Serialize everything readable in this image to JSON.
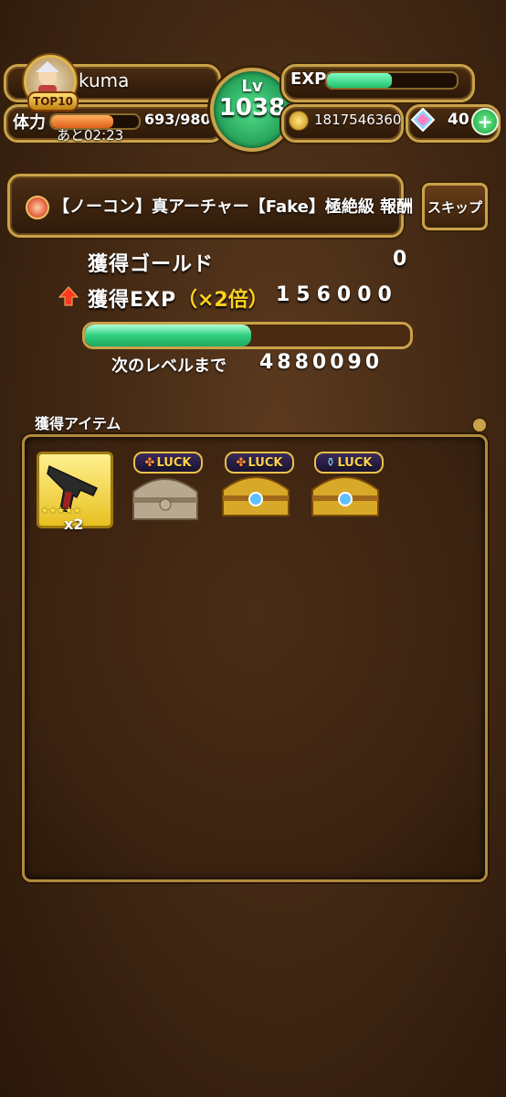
{
  "player": {
    "name": "kuma",
    "rank_badge": "TOP10",
    "level_label": "Lv",
    "level": "1038",
    "exp_label": "EXP",
    "exp_progress": 0.5,
    "stamina_label": "体力",
    "stamina_value": "693/980",
    "stamina_progress": 0.707,
    "stamina_timer": "あと02:23",
    "gold": "1817546360",
    "gems": "40"
  },
  "quest": {
    "title": "【ノーコン】真アーチャー【Fake】極絶級 報酬",
    "skip_label": "スキップ"
  },
  "rewards": {
    "gold_label": "獲得ゴールド",
    "gold_value": "0",
    "exp_label": "獲得EXP",
    "exp_multiplier": "（×2倍）",
    "exp_value": "156000",
    "next_level_label": "次のレベルまで",
    "next_level_value": "4880090",
    "next_level_progress": 0.51
  },
  "items": {
    "section_label": "獲得アイテム",
    "list": [
      {
        "type": "weapon",
        "icon": "pistol-icon",
        "stars": 5,
        "count": "x2"
      },
      {
        "type": "chest",
        "badge": "LUCK",
        "badge_icon": "clover-icon",
        "variant": "silver"
      },
      {
        "type": "chest",
        "badge": "LUCK",
        "badge_icon": "clover-icon",
        "variant": "gold"
      },
      {
        "type": "chest",
        "badge": "LUCK",
        "badge_icon": "potion-icon",
        "variant": "gold"
      }
    ]
  },
  "colors": {
    "accent_gold": "#c9a24a",
    "exp_green": "#36e08a",
    "stamina_orange": "#f07a20",
    "highlight_yellow": "#ffd21e"
  }
}
